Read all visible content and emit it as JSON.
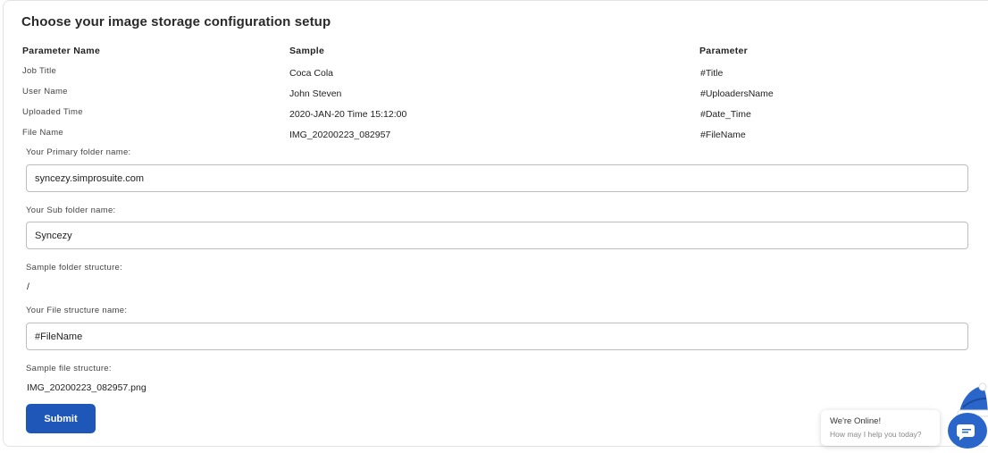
{
  "page": {
    "title": "Choose your image storage configuration setup"
  },
  "table": {
    "headers": [
      "Parameter Name",
      "Sample",
      "Parameter"
    ],
    "rows": [
      {
        "name": "Job Title",
        "sample": "Coca Cola",
        "param": "#Title"
      },
      {
        "name": "User Name",
        "sample": "John Steven",
        "param": "#UploadersName"
      },
      {
        "name": "Uploaded Time",
        "sample": "2020-JAN-20 Time 15:12:00",
        "param": "#Date_Time"
      },
      {
        "name": "File Name",
        "sample": "IMG_20200223_082957",
        "param": "#FileName"
      }
    ]
  },
  "form": {
    "primary_label": "Your Primary folder name:",
    "primary_value": "syncezy.simprosuite.com",
    "sub_label": "Your Sub folder name:",
    "sub_value": "Syncezy",
    "sample_folder_label": "Sample folder structure:",
    "sample_folder_value": "/",
    "file_label": "Your File structure name:",
    "file_value": "#FileName",
    "sample_file_label": "Sample file structure:",
    "sample_file_value": "IMG_20200223_082957.png",
    "submit_label": "Submit"
  },
  "chat": {
    "title": "We're Online!",
    "subtitle": "How may I help you today?",
    "launcher_icon": "chat-icon"
  },
  "colors": {
    "primary": "#1f57b8",
    "chat_launcher": "#2a66c9"
  }
}
